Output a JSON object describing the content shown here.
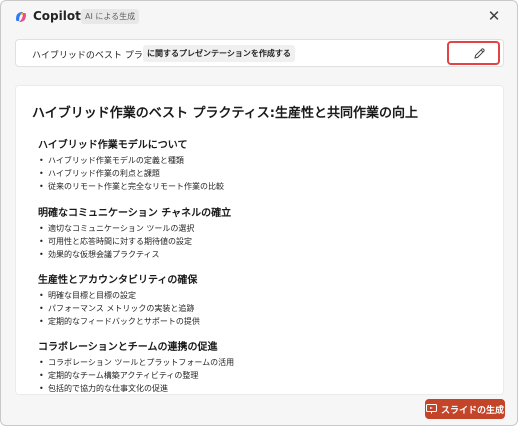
{
  "header": {
    "app_name": "Copilot",
    "ai_badge": "AI による生成",
    "close_glyph": "✕"
  },
  "prompt": {
    "text": "ハイブリッドのベスト プラクティス",
    "chip": "に関するプレゼンテーションを作成する",
    "edit_icon": "pencil-icon"
  },
  "document": {
    "title": "ハイブリッド作業のベスト プラクティス:生産性と共同作業の向上",
    "sections": [
      {
        "heading": "ハイブリッド作業モデルについて",
        "items": [
          "ハイブリッド作業モデルの定義と種類",
          "ハイブリッド作業の利点と課題",
          "従来のリモート作業と完全なリモート作業の比較"
        ]
      },
      {
        "heading": "明確なコミュニケーション チャネルの確立",
        "items": [
          "適切なコミュニケーション ツールの選択",
          "可用性と応答時間に対する期待値の設定",
          "効果的な仮想会議プラクティス"
        ]
      },
      {
        "heading": "生産性とアカウンタビリティの確保",
        "items": [
          "明確な目標と目標の設定",
          "パフォーマンス メトリックの実装と追跡",
          "定期的なフィードバックとサポートの提供"
        ]
      },
      {
        "heading": "コラボレーションとチームの連携の促進",
        "items": [
          "コラボレーション ツールとプラットフォームの活用",
          "定期的なチーム構築アクティビティの整理",
          "包括的で協力的な仕事文化の促進"
        ]
      }
    ]
  },
  "footer": {
    "generate_label": "スライドの生成",
    "generate_icon": "slides-icon",
    "accent_color": "#c4442a"
  }
}
